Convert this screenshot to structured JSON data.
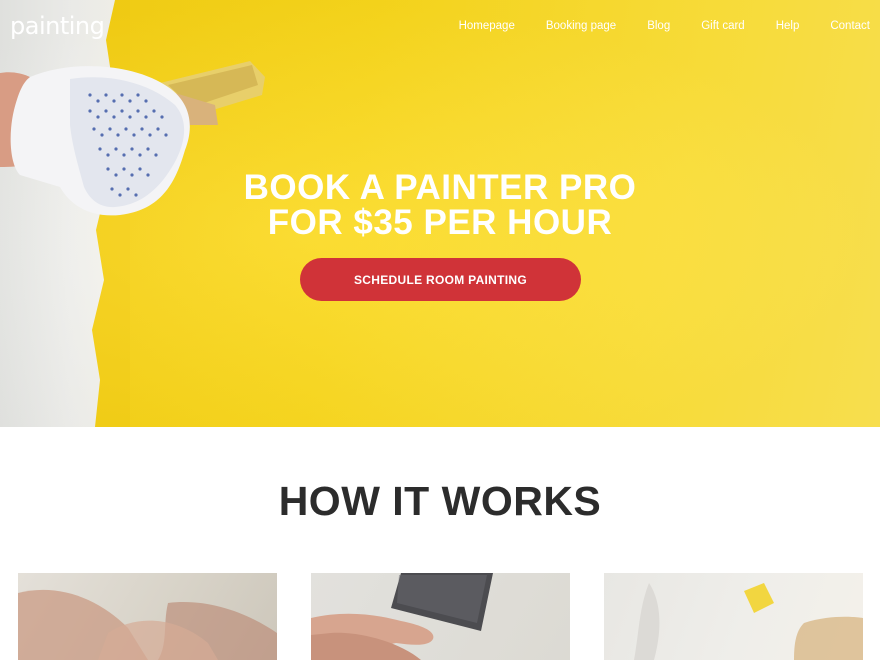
{
  "brand": {
    "logo": "painting"
  },
  "nav": {
    "items": [
      "Homepage",
      "Booking page",
      "Blog",
      "Gift card",
      "Help",
      "Contact"
    ]
  },
  "hero": {
    "title_line1": "BOOK A PAINTER PRO",
    "title_line2": "FOR $35 PER HOUR",
    "cta_label": "SCHEDULE ROOM PAINTING",
    "accent_color": "#d03338",
    "background_color": "#fbd91c"
  },
  "how_it_works": {
    "title": "HOW IT WORKS",
    "cards": [
      {
        "image": "handshake-photo"
      },
      {
        "image": "credit-card-photo"
      },
      {
        "image": "painting-wall-photo"
      }
    ]
  }
}
